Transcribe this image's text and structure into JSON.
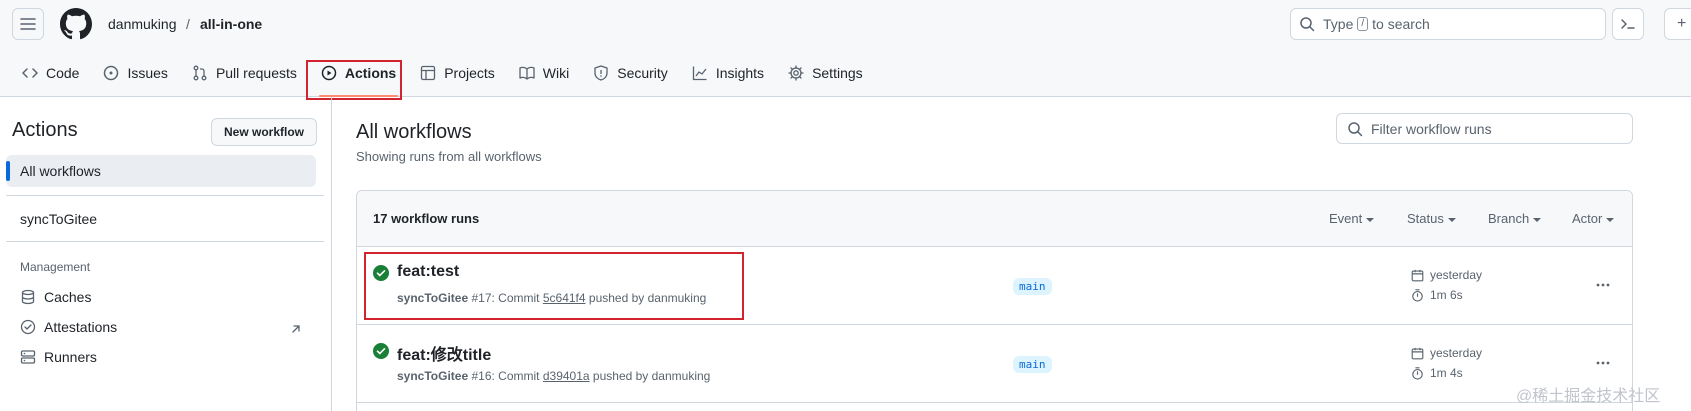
{
  "header": {
    "owner": "danmuking",
    "separator": "/",
    "repo": "all-in-one",
    "search_prefix": "Type",
    "search_key": "/",
    "search_suffix": "to search",
    "plus": "+"
  },
  "tabs": [
    {
      "label": "Code",
      "icon": "code-icon"
    },
    {
      "label": "Issues",
      "icon": "issue-icon"
    },
    {
      "label": "Pull requests",
      "icon": "pull-request-icon"
    },
    {
      "label": "Actions",
      "icon": "play-icon",
      "active": true
    },
    {
      "label": "Projects",
      "icon": "table-icon"
    },
    {
      "label": "Wiki",
      "icon": "book-icon"
    },
    {
      "label": "Security",
      "icon": "shield-icon"
    },
    {
      "label": "Insights",
      "icon": "graph-icon"
    },
    {
      "label": "Settings",
      "icon": "gear-icon"
    }
  ],
  "sidebar": {
    "title": "Actions",
    "new_workflow": "New workflow",
    "all_workflows": "All workflows",
    "workflow": "syncToGitee",
    "management_heading": "Management",
    "management_items": [
      {
        "label": "Caches",
        "icon": "database-icon"
      },
      {
        "label": "Attestations",
        "icon": "verified-icon"
      },
      {
        "label": "Runners",
        "icon": "server-icon"
      }
    ]
  },
  "main": {
    "title": "All workflows",
    "subtitle": "Showing runs from all workflows",
    "filter_placeholder": "Filter workflow runs",
    "runs_count": "17 workflow runs",
    "filters": [
      "Event",
      "Status",
      "Branch",
      "Actor"
    ],
    "runs": [
      {
        "title": "feat:test",
        "workflow": "syncToGitee",
        "number": "#17",
        "commit_prefix": ": Commit",
        "sha": "5c641f4",
        "pushed_by": "pushed by danmuking",
        "branch": "main",
        "when": "yesterday",
        "duration": "1m 6s",
        "status": "success"
      },
      {
        "title": "feat:修改title",
        "workflow": "syncToGitee",
        "number": "#16",
        "commit_prefix": ": Commit",
        "sha": "d39401a",
        "pushed_by": "pushed by danmuking",
        "branch": "main",
        "when": "yesterday",
        "duration": "1m 4s",
        "status": "success"
      }
    ]
  },
  "watermark": "@稀土掘金技术社区",
  "colors": {
    "success": "#1a7f37",
    "accent": "#0969da",
    "highlight": "#d1242f",
    "tab_underline": "#fd8c73"
  }
}
